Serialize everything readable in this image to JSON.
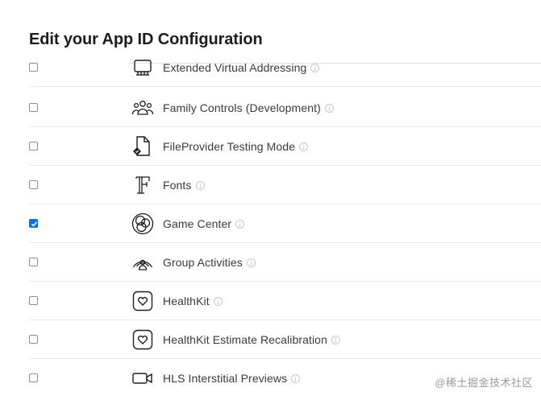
{
  "page": {
    "title": "Edit your App ID Configuration"
  },
  "capabilities": [
    {
      "label": "Extended Virtual Addressing",
      "checked": false,
      "icon": "memory-chip-icon"
    },
    {
      "label": "Family Controls (Development)",
      "checked": false,
      "icon": "people-group-icon"
    },
    {
      "label": "FileProvider Testing Mode",
      "checked": false,
      "icon": "document-check-icon"
    },
    {
      "label": "Fonts",
      "checked": false,
      "icon": "font-glyph-icon"
    },
    {
      "label": "Game Center",
      "checked": true,
      "icon": "game-center-icon"
    },
    {
      "label": "Group Activities",
      "checked": false,
      "icon": "shareplay-icon"
    },
    {
      "label": "HealthKit",
      "checked": false,
      "icon": "heart-icon"
    },
    {
      "label": "HealthKit Estimate Recalibration",
      "checked": false,
      "icon": "heart-icon"
    },
    {
      "label": "HLS Interstitial Previews",
      "checked": false,
      "icon": "video-camera-icon"
    }
  ],
  "colors": {
    "accent": "#0a6fe0",
    "text": "#3a3a3c",
    "separator": "#ebebee"
  },
  "watermark": "@稀土掘金技术社区"
}
